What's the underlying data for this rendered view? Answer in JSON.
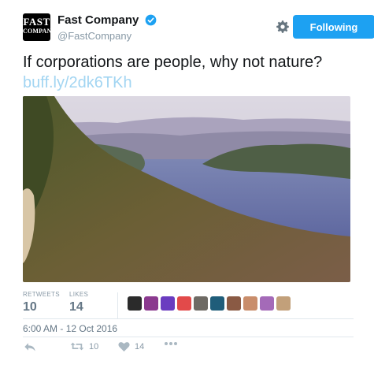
{
  "tweet": {
    "author": {
      "name": "Fast Company",
      "handle": "@FastCompany",
      "logo_text": "FAST COMPANY",
      "verified": true
    },
    "follow_button_label": "Following",
    "text": "If corporations are people, why not nature?",
    "link": "buff.ly/2dk6TKh",
    "timestamp": "6:00 AM - 12 Oct 2016"
  },
  "stats": {
    "retweets_label": "RETWEETS",
    "retweets_value": "10",
    "likes_label": "LIKES",
    "likes_value": "14"
  },
  "likers": [
    "avatar-1",
    "avatar-2",
    "avatar-3",
    "avatar-4",
    "avatar-5",
    "avatar-6",
    "avatar-7",
    "avatar-8",
    "avatar-9",
    "avatar-10"
  ],
  "actions": {
    "retweet_count": "10",
    "like_count": "14"
  },
  "colors": {
    "accent": "#1da1f2",
    "link": "#a2d5f2",
    "muted": "#8899a6"
  }
}
